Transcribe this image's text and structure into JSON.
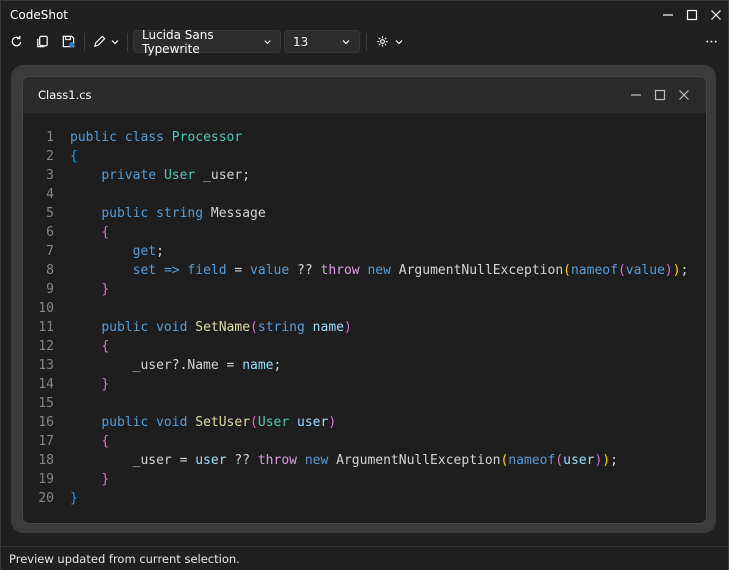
{
  "window": {
    "title": "CodeShot"
  },
  "toolbar": {
    "font_family": "Lucida Sans Typewrite",
    "font_size": "13"
  },
  "editor": {
    "file_title": "Class1.cs",
    "lines": [
      {
        "n": "1",
        "tokens": [
          {
            "t": "public",
            "c": "kw"
          },
          {
            "t": " "
          },
          {
            "t": "class",
            "c": "kw"
          },
          {
            "t": " "
          },
          {
            "t": "Processor",
            "c": "type"
          }
        ]
      },
      {
        "n": "2",
        "tokens": [
          {
            "t": "{",
            "c": "b3"
          }
        ]
      },
      {
        "n": "3",
        "tokens": [
          {
            "t": "    "
          },
          {
            "t": "private",
            "c": "kw"
          },
          {
            "t": " "
          },
          {
            "t": "User",
            "c": "type"
          },
          {
            "t": " _user;"
          }
        ]
      },
      {
        "n": "4",
        "tokens": []
      },
      {
        "n": "5",
        "tokens": [
          {
            "t": "    "
          },
          {
            "t": "public",
            "c": "kw"
          },
          {
            "t": " "
          },
          {
            "t": "string",
            "c": "kw"
          },
          {
            "t": " Message"
          }
        ]
      },
      {
        "n": "6",
        "tokens": [
          {
            "t": "    "
          },
          {
            "t": "{",
            "c": "b2"
          }
        ]
      },
      {
        "n": "7",
        "tokens": [
          {
            "t": "        "
          },
          {
            "t": "get",
            "c": "kw"
          },
          {
            "t": ";"
          }
        ]
      },
      {
        "n": "8",
        "tokens": [
          {
            "t": "        "
          },
          {
            "t": "set",
            "c": "kw"
          },
          {
            "t": " "
          },
          {
            "t": "=>",
            "c": "kw"
          },
          {
            "t": " "
          },
          {
            "t": "field",
            "c": "kw"
          },
          {
            "t": " = "
          },
          {
            "t": "value",
            "c": "kw"
          },
          {
            "t": " ?? "
          },
          {
            "t": "throw",
            "c": "ctl"
          },
          {
            "t": " "
          },
          {
            "t": "new",
            "c": "kw"
          },
          {
            "t": " ArgumentNullException"
          },
          {
            "t": "(",
            "c": "b1"
          },
          {
            "t": "nameof",
            "c": "kw"
          },
          {
            "t": "(",
            "c": "b2"
          },
          {
            "t": "value",
            "c": "kw"
          },
          {
            "t": ")",
            "c": "b2"
          },
          {
            "t": ")",
            "c": "b1"
          },
          {
            "t": ";"
          }
        ]
      },
      {
        "n": "9",
        "tokens": [
          {
            "t": "    "
          },
          {
            "t": "}",
            "c": "b2"
          }
        ]
      },
      {
        "n": "10",
        "tokens": []
      },
      {
        "n": "11",
        "tokens": [
          {
            "t": "    "
          },
          {
            "t": "public",
            "c": "kw"
          },
          {
            "t": " "
          },
          {
            "t": "void",
            "c": "kw"
          },
          {
            "t": " "
          },
          {
            "t": "SetName",
            "c": "meth"
          },
          {
            "t": "(",
            "c": "b2"
          },
          {
            "t": "string",
            "c": "kw"
          },
          {
            "t": " "
          },
          {
            "t": "name",
            "c": "var"
          },
          {
            "t": ")",
            "c": "b2"
          }
        ]
      },
      {
        "n": "12",
        "tokens": [
          {
            "t": "    "
          },
          {
            "t": "{",
            "c": "b2"
          }
        ]
      },
      {
        "n": "13",
        "tokens": [
          {
            "t": "        _user?.Name = "
          },
          {
            "t": "name",
            "c": "var"
          },
          {
            "t": ";"
          }
        ]
      },
      {
        "n": "14",
        "tokens": [
          {
            "t": "    "
          },
          {
            "t": "}",
            "c": "b2"
          }
        ]
      },
      {
        "n": "15",
        "tokens": []
      },
      {
        "n": "16",
        "tokens": [
          {
            "t": "    "
          },
          {
            "t": "public",
            "c": "kw"
          },
          {
            "t": " "
          },
          {
            "t": "void",
            "c": "kw"
          },
          {
            "t": " "
          },
          {
            "t": "SetUser",
            "c": "meth"
          },
          {
            "t": "(",
            "c": "b2"
          },
          {
            "t": "User",
            "c": "type"
          },
          {
            "t": " "
          },
          {
            "t": "user",
            "c": "var"
          },
          {
            "t": ")",
            "c": "b2"
          }
        ]
      },
      {
        "n": "17",
        "tokens": [
          {
            "t": "    "
          },
          {
            "t": "{",
            "c": "b2"
          }
        ]
      },
      {
        "n": "18",
        "tokens": [
          {
            "t": "        _user = "
          },
          {
            "t": "user",
            "c": "var"
          },
          {
            "t": " ?? "
          },
          {
            "t": "throw",
            "c": "ctl"
          },
          {
            "t": " "
          },
          {
            "t": "new",
            "c": "kw"
          },
          {
            "t": " ArgumentNullException"
          },
          {
            "t": "(",
            "c": "b1"
          },
          {
            "t": "nameof",
            "c": "kw"
          },
          {
            "t": "(",
            "c": "b2"
          },
          {
            "t": "user",
            "c": "var"
          },
          {
            "t": ")",
            "c": "b2"
          },
          {
            "t": ")",
            "c": "b1"
          },
          {
            "t": ";"
          }
        ]
      },
      {
        "n": "19",
        "tokens": [
          {
            "t": "    "
          },
          {
            "t": "}",
            "c": "b2"
          }
        ]
      },
      {
        "n": "20",
        "tokens": [
          {
            "t": "}",
            "c": "b3"
          }
        ]
      }
    ]
  },
  "status": {
    "text": "Preview updated from current selection."
  },
  "icons": {
    "refresh": "refresh-icon",
    "copy": "copy-icon",
    "save": "save-icon",
    "pen": "pen-icon",
    "settings": "gear-icon",
    "more": "more-icon"
  }
}
